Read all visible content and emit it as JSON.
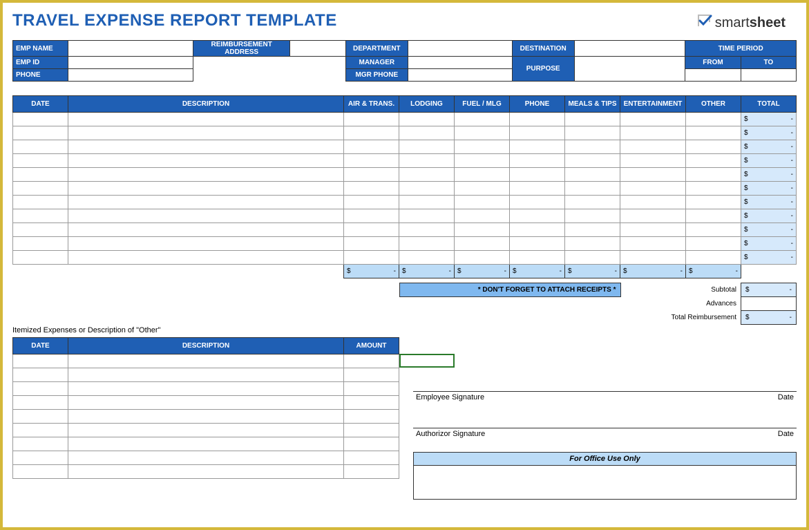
{
  "title": "TRAVEL EXPENSE REPORT TEMPLATE",
  "logo": {
    "part1": "smart",
    "part2": "sheet"
  },
  "header": {
    "empName": "EMP NAME",
    "reimbAddr": "REIMBURSEMENT ADDRESS",
    "department": "DEPARTMENT",
    "destination": "DESTINATION",
    "timePeriod": "TIME PERIOD",
    "empId": "EMP ID",
    "manager": "MANAGER",
    "purpose": "PURPOSE",
    "from": "FROM",
    "to": "TO",
    "phone": "PHONE",
    "mgrPhone": "MGR PHONE"
  },
  "mainCols": {
    "date": "DATE",
    "description": "DESCRIPTION",
    "airTrans": "AIR & TRANS.",
    "lodging": "LODGING",
    "fuelMlg": "FUEL / MLG",
    "phone": "PHONE",
    "mealsTips": "MEALS & TIPS",
    "entertainment": "ENTERTAINMENT",
    "other": "OTHER",
    "total": "TOTAL"
  },
  "rowTotal": {
    "sym": "$",
    "dash": "-"
  },
  "colSubtotal": {
    "sym": "$",
    "dash": "-"
  },
  "reminder": "* DON'T FORGET TO ATTACH RECEIPTS *",
  "summary": {
    "subtotal": "Subtotal",
    "advances": "Advances",
    "totalReimb": "Total Reimbursement"
  },
  "itemizedLabel": "Itemized Expenses or Description of \"Other\"",
  "itemCols": {
    "date": "DATE",
    "description": "DESCRIPTION",
    "amount": "AMOUNT"
  },
  "sig": {
    "emp": "Employee Signature",
    "auth": "Authorizor Signature",
    "date": "Date"
  },
  "officeUse": "For Office Use Only"
}
